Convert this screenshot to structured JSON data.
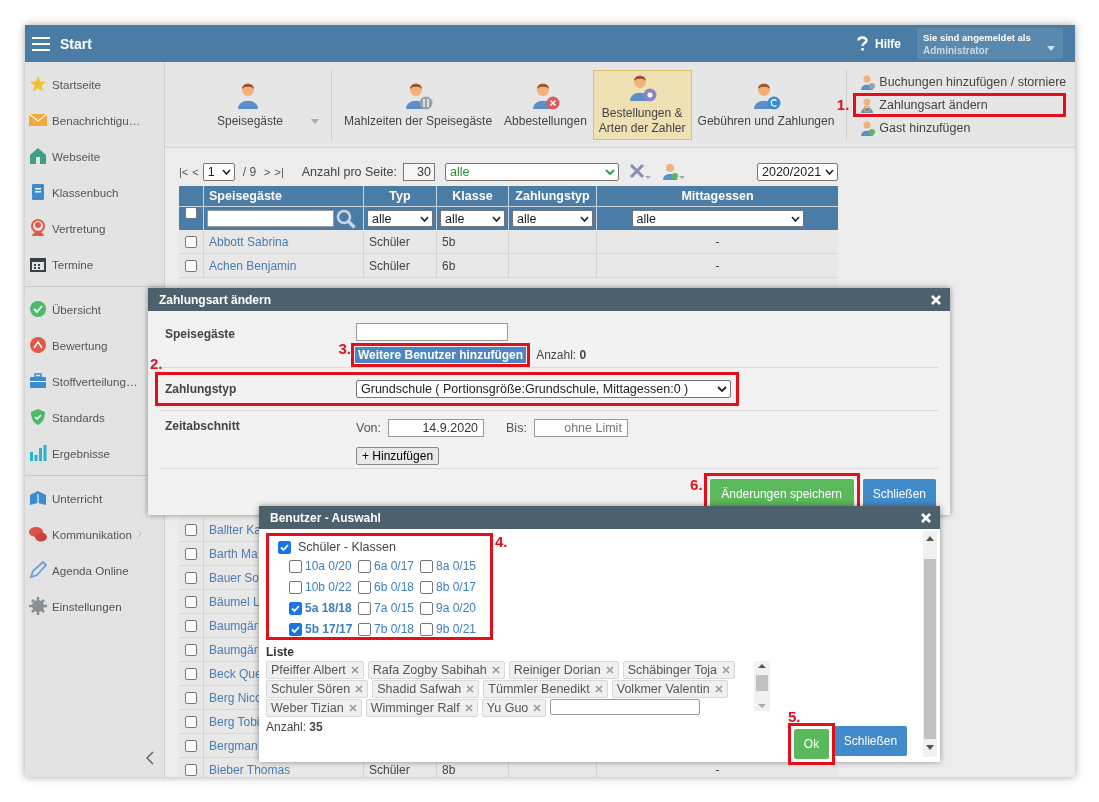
{
  "header": {
    "title": "Start",
    "help": "Hilfe",
    "account_label": "Sie sind angemeldet als",
    "account_user": "Administrator"
  },
  "sidebar": {
    "groups": [
      [
        {
          "label": "Startseite",
          "submenu": false
        },
        {
          "label": "Benachrichtigu…",
          "submenu": false
        },
        {
          "label": "Webseite",
          "submenu": false
        },
        {
          "label": "Klassenbuch",
          "submenu": false
        },
        {
          "label": "Vertretung",
          "submenu": false
        },
        {
          "label": "Termine",
          "submenu": false
        }
      ],
      [
        {
          "label": "Übersicht",
          "submenu": false
        },
        {
          "label": "Bewertung",
          "submenu": false
        },
        {
          "label": "Stoffverteilung…",
          "submenu": false
        },
        {
          "label": "Standards",
          "submenu": false
        },
        {
          "label": "Ergebnisse",
          "submenu": false
        }
      ],
      [
        {
          "label": "Unterricht",
          "submenu": false
        },
        {
          "label": "Kommunikation",
          "submenu": true
        },
        {
          "label": "Agenda Online",
          "submenu": false
        },
        {
          "label": "Einstellungen",
          "submenu": false
        }
      ]
    ]
  },
  "toolbar": {
    "buttons": [
      {
        "label": "Speisegäste",
        "selected": false,
        "dropdown": true
      },
      {
        "label": "Mahlzeiten der Speisegäste",
        "selected": false,
        "dropdown": false
      },
      {
        "label": "Abbestellungen",
        "selected": false,
        "dropdown": false
      },
      {
        "label": "Bestellungen &\nArten der Zahler",
        "selected": true,
        "dropdown": false
      },
      {
        "label": "Gebühren und Zahlungen",
        "selected": false,
        "dropdown": false
      }
    ],
    "actions": [
      {
        "label": "Buchungen hinzufügen / storniere"
      },
      {
        "label": "Zahlungsart ändern",
        "callout": "1."
      },
      {
        "label": "Gast hinzufügen"
      }
    ]
  },
  "pager": {
    "first": "|<",
    "prev": "<",
    "page": "1",
    "pages": "/ 9",
    "next": ">",
    "last": ">|",
    "per_page_label": "Anzahl pro Seite:",
    "per_page": "30",
    "filter": "alle",
    "year": "2020/2021"
  },
  "table": {
    "select_all_checked": false,
    "columns": [
      "Speisegäste",
      "Typ",
      "Klasse",
      "Zahlungstyp",
      "Mittagessen"
    ],
    "filters": [
      "alle",
      "alle",
      "alle",
      "alle"
    ],
    "rows": [
      {
        "name": "Abbott Sabrina",
        "typ": "Schüler",
        "klasse": "5b",
        "mittagessen": "-",
        "checked": false
      },
      {
        "name": "Achen Benjamin",
        "typ": "Schüler",
        "klasse": "6b",
        "mittagessen": "-",
        "checked": false
      },
      {
        "name": "Ballter Ka",
        "checked": false
      },
      {
        "name": "Barth Ma",
        "checked": false
      },
      {
        "name": "Bauer So",
        "checked": false
      },
      {
        "name": "Bäumel L",
        "checked": false
      },
      {
        "name": "Baumgär",
        "checked": false
      },
      {
        "name": "Baumgär",
        "checked": false
      },
      {
        "name": "Beck Que",
        "checked": false
      },
      {
        "name": "Berg Nicc",
        "checked": false
      },
      {
        "name": "Berg Tobi",
        "checked": false
      },
      {
        "name": "Bergman",
        "checked": false
      },
      {
        "name": "Bieber Thomas",
        "typ": "Schüler",
        "klasse": "8b",
        "mittagessen": "-",
        "checked": false
      }
    ]
  },
  "payment_dialog": {
    "title": "Zahlungsart ändern",
    "guests_label": "Speisegäste",
    "add_users": {
      "label": "Weitere Benutzer hinzufügen",
      "callout": "3."
    },
    "count": "Anzahl: **0**",
    "type_label": "Zahlungstyp",
    "type_value": "Grundschule ( Portionsgröße:Grundschule, Mittagessen:0 )",
    "type_callout": "2.",
    "period_label": "Zeitabschnitt",
    "from_label": "Von:",
    "from": "14.9.2020",
    "to_label": "Bis:",
    "to_placeholder": "ohne Limit",
    "add": "+ Hinzufügen",
    "save": {
      "label": "Änderungen speichern",
      "callout": "6."
    },
    "close": "Schließen"
  },
  "user_dialog": {
    "title": "Benutzer - Auswahl",
    "group": {
      "label": "Schüler - Klassen",
      "checked": true,
      "callout": "4.",
      "classes": [
        {
          "label": "10a 0/20",
          "checked": false
        },
        {
          "label": "6a 0/17",
          "checked": false
        },
        {
          "label": "8a 0/15",
          "checked": false
        },
        {
          "label": "10b 0/22",
          "checked": false
        },
        {
          "label": "6b 0/18",
          "checked": false
        },
        {
          "label": "8b 0/17",
          "checked": false
        },
        {
          "label": "5a 18/18",
          "checked": true
        },
        {
          "label": "7a 0/15",
          "checked": false
        },
        {
          "label": "9a 0/20",
          "checked": false
        },
        {
          "label": "5b 17/17",
          "checked": true
        },
        {
          "label": "7b 0/18",
          "checked": false
        },
        {
          "label": "9b 0/21",
          "checked": false
        }
      ]
    },
    "list_label": "Liste",
    "tags": [
      "Pfeiffer Albert",
      "Rafa Zogby Sabihah",
      "Reiniger Dorian",
      "Schäbinger Toja",
      "Schuler Sören",
      "Shadid Safwah",
      "Tümmler Benedikt",
      "Volkmer Valentin",
      "Weber Tizian",
      "Wimminger Ralf",
      "Yu Guo"
    ],
    "count": "Anzahl: **35**",
    "ok": {
      "label": "Ok",
      "callout": "5."
    },
    "close": "Schließen"
  }
}
